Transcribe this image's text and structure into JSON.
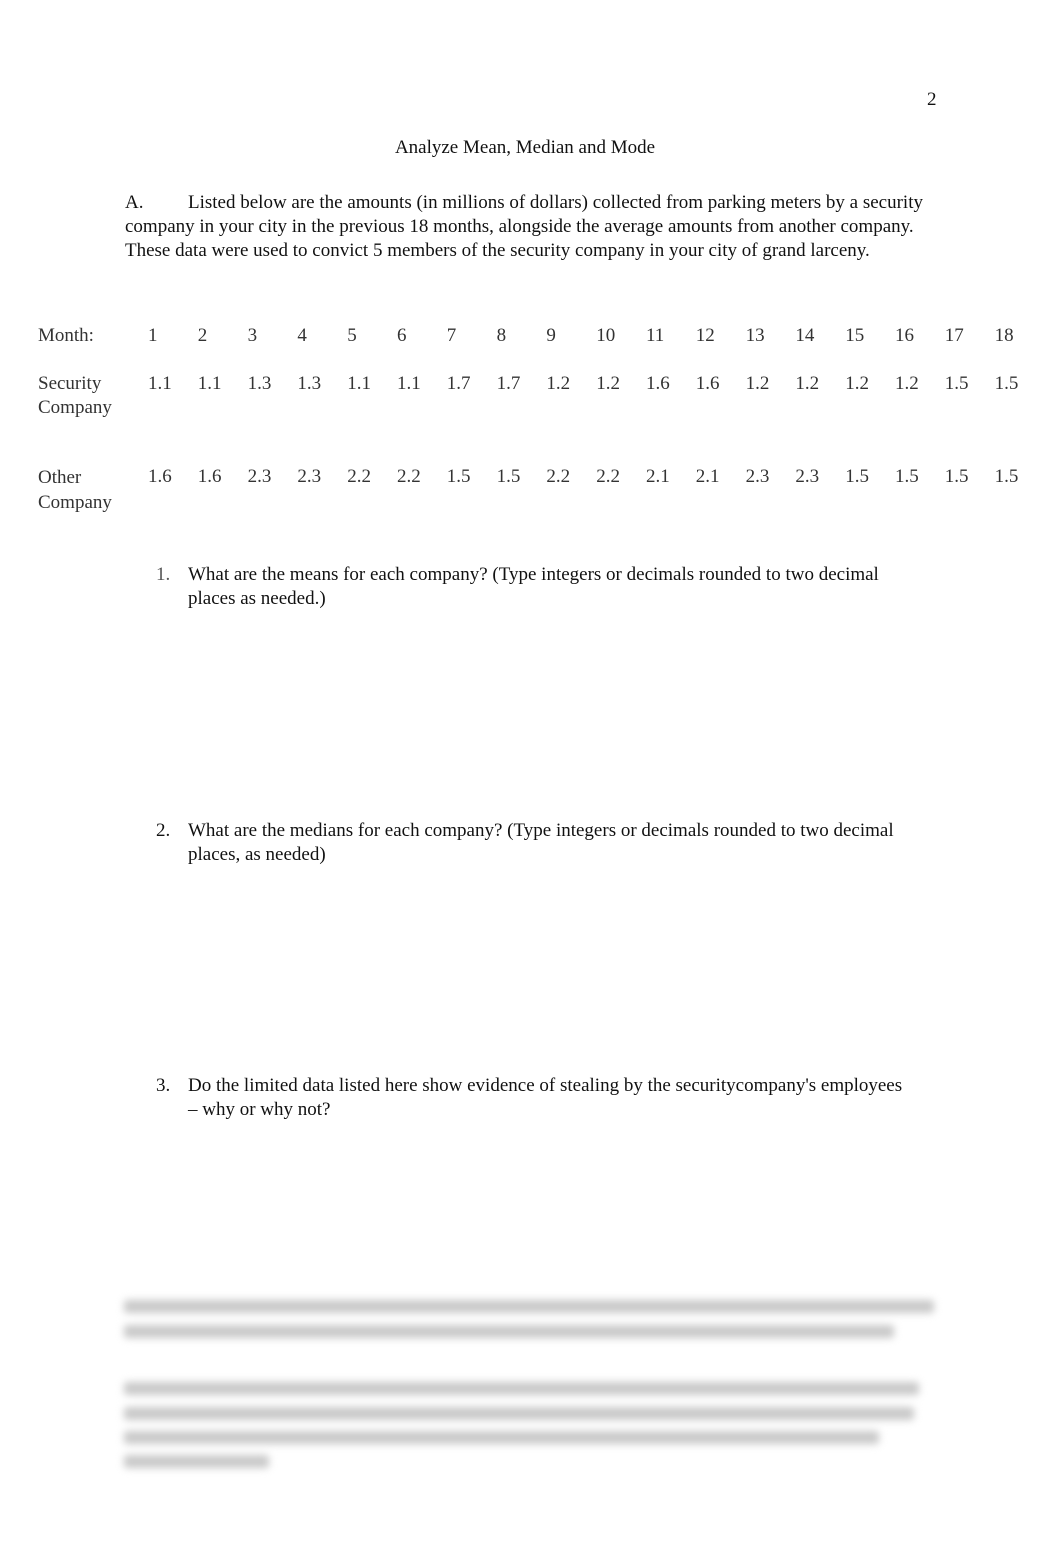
{
  "page_number": "2",
  "title": "Analyze Mean, Median and Mode",
  "section": {
    "label": "A.",
    "text": "Listed below are the amounts (in millions of dollars) collected from parking meters by a security company in your city in the previous 18 months, alongside the average amounts from another company. These data were used to convict 5 members of the security company in your city of grand larceny."
  },
  "table": {
    "month_label": "Month:",
    "months": [
      "1",
      "2",
      "3",
      "4",
      "5",
      "6",
      "7",
      "8",
      "9",
      "10",
      "11",
      "12",
      "13",
      "14",
      "15",
      "16",
      "17",
      "18"
    ],
    "rows": [
      {
        "label_line1": "Security",
        "label_line2": "Company",
        "values": [
          "1.1",
          "1.1",
          "1.3",
          "1.3",
          "1.1",
          "1.1",
          "1.7",
          "1.7",
          "1.2",
          "1.2",
          "1.6",
          "1.6",
          "1.2",
          "1.2",
          "1.2",
          "1.2",
          "1.5",
          "1.5"
        ]
      },
      {
        "label_line1": "Other",
        "label_line2": "Company",
        "values": [
          "1.6",
          "1.6",
          "2.3",
          "2.3",
          "2.2",
          "2.2",
          "1.5",
          "1.5",
          "2.2",
          "2.2",
          "2.1",
          "2.1",
          "2.3",
          "2.3",
          "1.5",
          "1.5",
          "1.5",
          "1.5"
        ]
      }
    ]
  },
  "questions": [
    {
      "num": "1.",
      "text": "What are the means for each company? (Type integers or decimals rounded to two decimal places as needed.)"
    },
    {
      "num": "2.",
      "text": "What are the medians for each company? (Type integers or decimals rounded to two decimal places, as needed)"
    },
    {
      "num": "3.",
      "text": "Do the limited data listed here show evidence of stealing by the securitycompany's employees – why or why not?"
    }
  ]
}
